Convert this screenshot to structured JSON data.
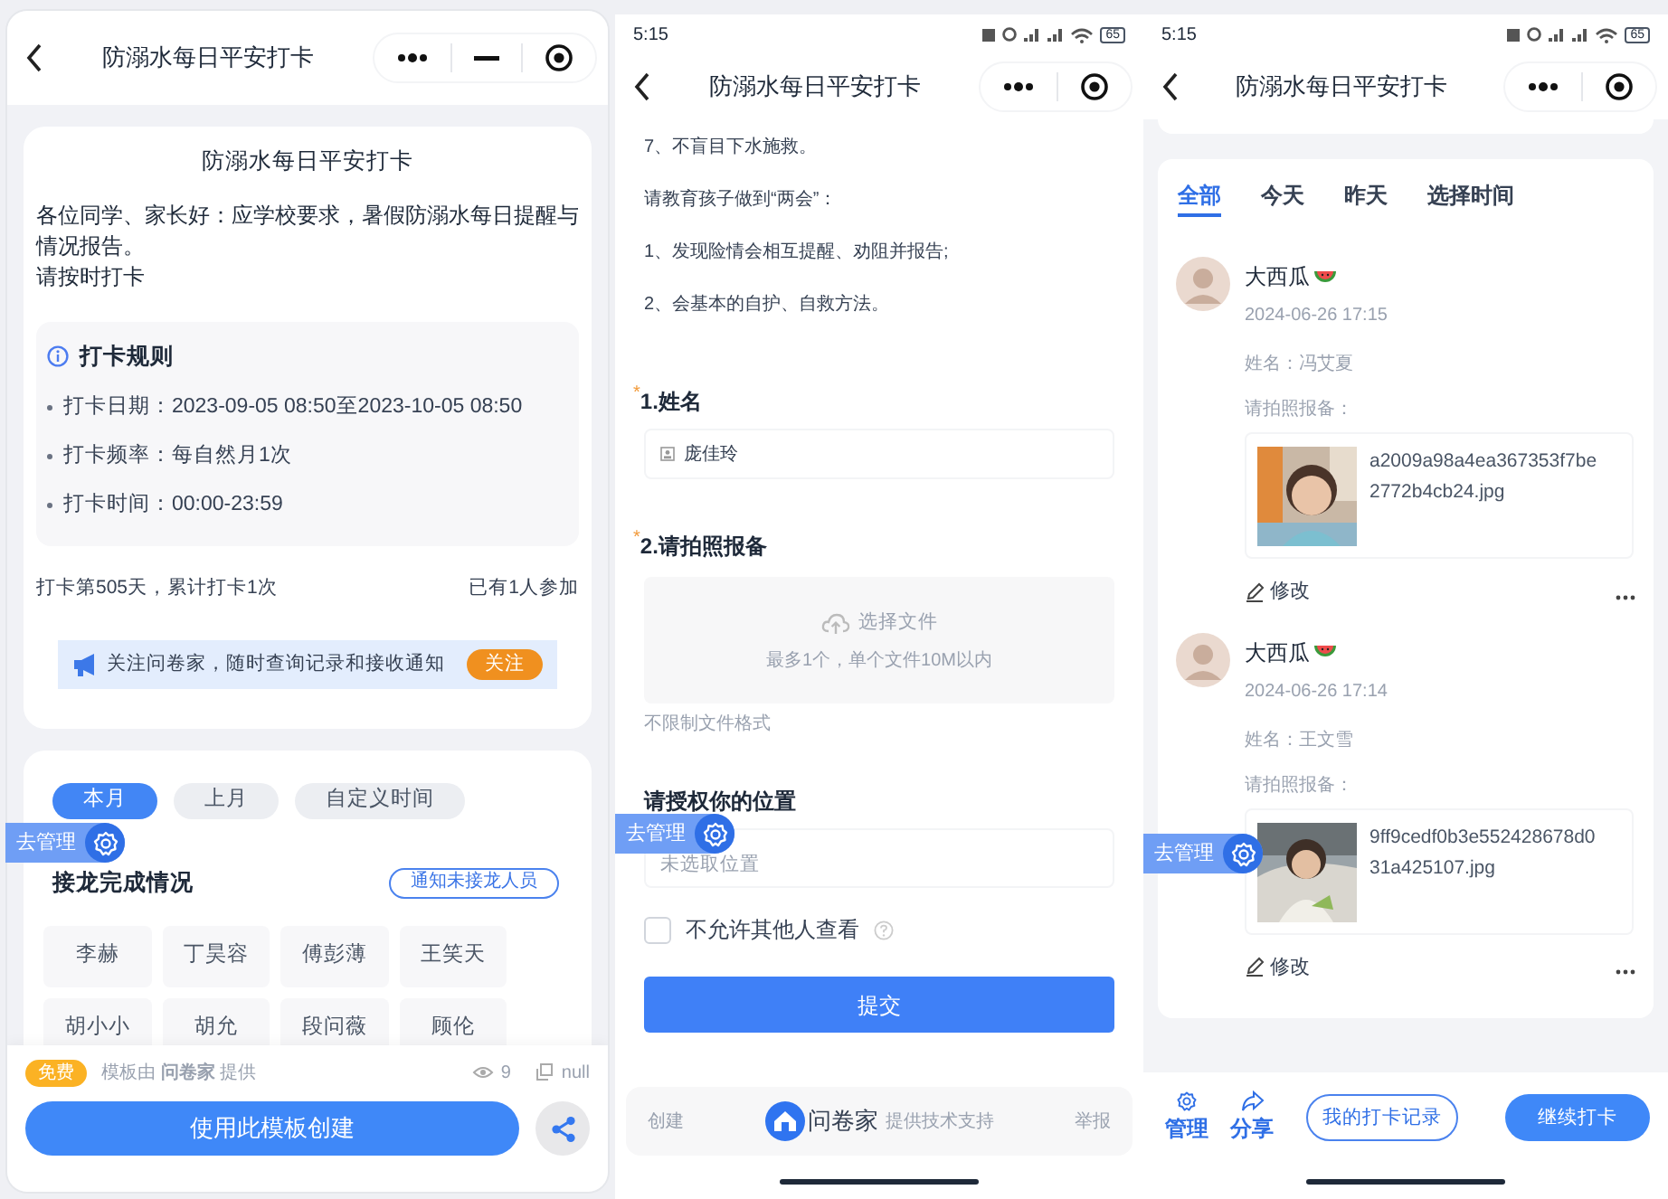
{
  "template_page": {
    "nav": {
      "title": "防溺水每日平安打卡"
    },
    "card": {
      "title": "防溺水每日平安打卡",
      "description": [
        "各位同学、家长好：应学校要求，暑假防溺水每日提醒与情况报告。",
        "请按时打卡"
      ],
      "rules": {
        "title": "打卡规则",
        "items": [
          "打卡日期：2023-09-05 08:50至2023-10-05 08:50",
          "打卡频率：每自然月1次",
          "打卡时间：00:00-23:59"
        ]
      },
      "stats_left": "打卡第505天，累计打卡1次",
      "stats_right": "已有1人参加",
      "banner": {
        "text": "关注问卷家，随时查询记录和接收通知",
        "button": "关注"
      }
    },
    "tabs": [
      {
        "label": "本月",
        "selected": true
      },
      {
        "label": "上月",
        "selected": false
      },
      {
        "label": "自定义时间",
        "selected": false
      }
    ],
    "manage_badge": "去管理",
    "section_title": "接龙完成情况",
    "notify_button": "通知未接龙人员",
    "names": [
      "李赫",
      "丁昊容",
      "傅彭薄",
      "王笑天",
      "胡小小",
      "胡允",
      "段问薇",
      "顾伦"
    ],
    "footer": {
      "badge": "免费",
      "provider": "模板由 **问卷家** 提供",
      "views": "9",
      "copies": "null",
      "create_button": "使用此模板创建"
    }
  },
  "form_page": {
    "status": {
      "time": "5:15",
      "battery": "65"
    },
    "nav": {
      "title": "防溺水每日平安打卡"
    },
    "paragraphs": [
      "7、不盲目下水施救。",
      "请教育孩子做到“两会”：",
      "1、发现险情会相互提醒、劝阻并报告;",
      "2、会基本的自护、自救方法。"
    ],
    "name_question": {
      "required_mark": "*",
      "label": "1.姓名",
      "value": "庞佳玲"
    },
    "photo_question": {
      "required_mark": "*",
      "label": "2.请拍照报备",
      "upload": "选择文件",
      "upload_hint": "最多1个，单个文件10M以内",
      "note": "不限制文件格式"
    },
    "location_question": {
      "label": "请授权你的位置",
      "placeholder": "未选取位置"
    },
    "private_option": {
      "label": "不允许其他人查看",
      "checked": false
    },
    "submit": "提交",
    "manage_badge": "去管理",
    "footer": {
      "left": "创建",
      "brand": "问卷家",
      "support": "提供技术支持",
      "right": "举报"
    }
  },
  "records_page": {
    "status": {
      "time": "5:15",
      "battery": "65"
    },
    "nav": {
      "title": "防溺水每日平安打卡"
    },
    "tabs": [
      {
        "label": "全部",
        "selected": true
      },
      {
        "label": "今天",
        "selected": false
      },
      {
        "label": "昨天",
        "selected": false
      },
      {
        "label": "选择时间",
        "selected": false
      }
    ],
    "records": [
      {
        "user": "大西瓜",
        "time": "2024-06-26 17:15",
        "name_line": "姓名：冯艾夏",
        "photo_label": "请拍照报备：",
        "file": "a2009a98a4ea367353f7be2772b4cb24.jpg",
        "edit": "修改"
      },
      {
        "user": "大西瓜",
        "time": "2024-06-26 17:14",
        "name_line": "姓名：王文雪",
        "photo_label": "请拍照报备：",
        "file": "9ff9cedf0b3e552428678d031a425107.jpg",
        "edit": "修改"
      }
    ],
    "manage_badge": "去管理",
    "bottom": {
      "manage": "管理",
      "share": "分享",
      "my_records": "我的打卡记录",
      "continue": "继续打卡"
    }
  }
}
